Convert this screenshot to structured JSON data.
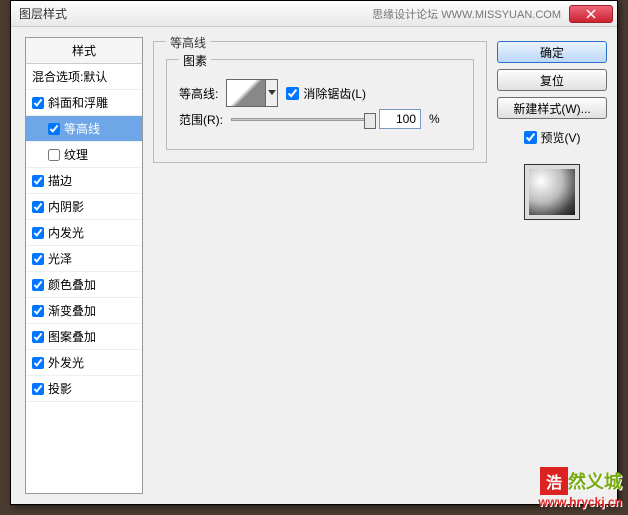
{
  "window": {
    "title": "图层样式",
    "subtitle": "思缘设计论坛   WWW.MISSYUAN.COM"
  },
  "sidebar": {
    "header": "样式",
    "blending": "混合选项:默认",
    "items": [
      {
        "label": "斜面和浮雕",
        "checked": true,
        "indent": false,
        "selected": false
      },
      {
        "label": "等高线",
        "checked": true,
        "indent": true,
        "selected": true
      },
      {
        "label": "纹理",
        "checked": false,
        "indent": true,
        "selected": false
      },
      {
        "label": "描边",
        "checked": true,
        "indent": false,
        "selected": false
      },
      {
        "label": "内阴影",
        "checked": true,
        "indent": false,
        "selected": false
      },
      {
        "label": "内发光",
        "checked": true,
        "indent": false,
        "selected": false
      },
      {
        "label": "光泽",
        "checked": true,
        "indent": false,
        "selected": false
      },
      {
        "label": "颜色叠加",
        "checked": true,
        "indent": false,
        "selected": false
      },
      {
        "label": "渐变叠加",
        "checked": true,
        "indent": false,
        "selected": false
      },
      {
        "label": "图案叠加",
        "checked": true,
        "indent": false,
        "selected": false
      },
      {
        "label": "外发光",
        "checked": true,
        "indent": false,
        "selected": false
      },
      {
        "label": "投影",
        "checked": true,
        "indent": false,
        "selected": false
      }
    ]
  },
  "panel": {
    "group_title": "等高线",
    "elements_title": "图素",
    "contour_label": "等高线:",
    "antialias_label": "消除锯齿(L)",
    "antialias_checked": true,
    "range_label": "范围(R):",
    "range_value": "100",
    "range_unit": "%"
  },
  "buttons": {
    "ok": "确定",
    "cancel": "复位",
    "new_style": "新建样式(W)...",
    "preview": "预览(V)",
    "preview_checked": true
  },
  "watermark": {
    "logo": "浩",
    "text": "然义城",
    "url": "www.hryckj.cn"
  }
}
